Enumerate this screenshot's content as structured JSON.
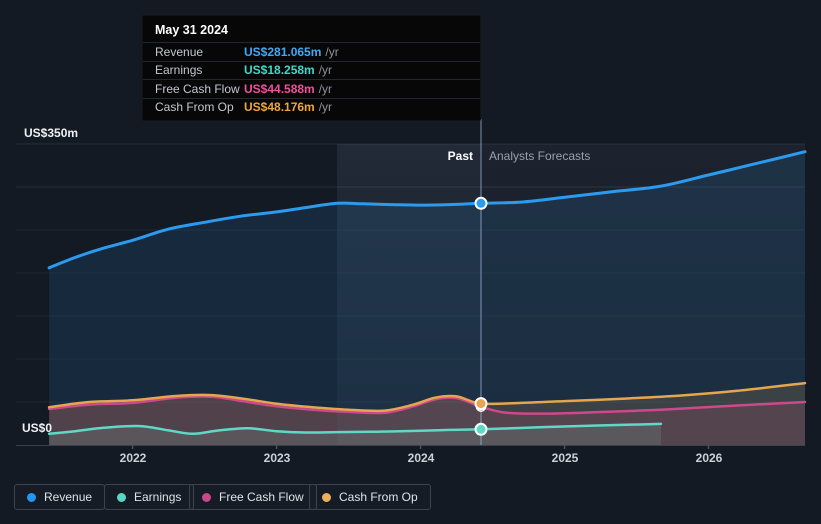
{
  "tooltip": {
    "title": "May 31 2024",
    "unit_suffix": " /yr",
    "rows": [
      {
        "label": "Revenue",
        "value": "US$281.065m",
        "color": "#40aaf5"
      },
      {
        "label": "Earnings",
        "value": "US$18.258m",
        "color": "#3fd9c4"
      },
      {
        "label": "Free Cash Flow",
        "value": "US$44.588m",
        "color": "#f0509d"
      },
      {
        "label": "Cash From Op",
        "value": "US$48.176m",
        "color": "#f0a63e"
      }
    ]
  },
  "axis": {
    "y_top_label": "US$350m",
    "y_zero_label": "US$0",
    "past_label": "Past",
    "forecast_label": "Analysts Forecasts"
  },
  "legend": {
    "items": [
      {
        "label": "Revenue",
        "color": "#2196f3"
      },
      {
        "label": "Earnings",
        "color": "#57d8c4"
      },
      {
        "label": "Free Cash Flow",
        "color": "#c9478c"
      },
      {
        "label": "Cash From Op",
        "color": "#eab05c"
      }
    ]
  },
  "chart_data": {
    "type": "line",
    "unit": "US$ millions per year",
    "ylim": [
      0,
      350
    ],
    "xlim": [
      2021.19,
      2026.67
    ],
    "x_ticks": [
      2022,
      2023,
      2024,
      2025,
      2026
    ],
    "y_gridline_interval": 50,
    "grid": true,
    "divider_x": 2024.42,
    "divider_date": "May 31 2024",
    "highlight_band": [
      2023.42,
      2024.42
    ],
    "forecast_start": 2024.42,
    "series": [
      {
        "name": "Revenue",
        "color": "#2b9bf0",
        "fill": "rgba(45,140,220,0.14)",
        "width": 3,
        "divider_value": 281.065,
        "points": [
          [
            2021.42,
            206
          ],
          [
            2021.6,
            218
          ],
          [
            2021.8,
            229
          ],
          [
            2022.0,
            238
          ],
          [
            2022.25,
            251
          ],
          [
            2022.5,
            259
          ],
          [
            2022.75,
            266
          ],
          [
            2023.0,
            271
          ],
          [
            2023.2,
            276
          ],
          [
            2023.42,
            281
          ],
          [
            2023.6,
            280.5
          ],
          [
            2023.8,
            279.5
          ],
          [
            2024.0,
            279
          ],
          [
            2024.2,
            279.5
          ],
          [
            2024.42,
            281.065
          ],
          [
            2024.7,
            282.5
          ],
          [
            2025.0,
            288
          ],
          [
            2025.3,
            294
          ],
          [
            2025.67,
            301
          ],
          [
            2026.0,
            314
          ],
          [
            2026.3,
            326
          ],
          [
            2026.67,
            341
          ]
        ]
      },
      {
        "name": "Earnings",
        "color": "#5fd9c5",
        "fill": "rgba(95,217,197,0.16)",
        "width": 2.5,
        "divider_value": 18.258,
        "points": [
          [
            2021.42,
            13
          ],
          [
            2021.6,
            16
          ],
          [
            2021.8,
            20
          ],
          [
            2022.05,
            22
          ],
          [
            2022.25,
            17
          ],
          [
            2022.42,
            13
          ],
          [
            2022.6,
            17
          ],
          [
            2022.8,
            19.5
          ],
          [
            2023.0,
            16
          ],
          [
            2023.2,
            14.5
          ],
          [
            2023.42,
            15
          ],
          [
            2023.7,
            15.5
          ],
          [
            2024.0,
            16.5
          ],
          [
            2024.2,
            17.5
          ],
          [
            2024.42,
            18.258
          ],
          [
            2024.8,
            20.5
          ],
          [
            2025.2,
            22.5
          ],
          [
            2025.67,
            24.5
          ]
        ]
      },
      {
        "name": "Free Cash Flow",
        "color": "#cc4a8b",
        "fill": "rgba(204,74,139,0.17)",
        "width": 2.5,
        "divider_value": 44.588,
        "points": [
          [
            2021.42,
            42
          ],
          [
            2021.7,
            47
          ],
          [
            2022.0,
            49
          ],
          [
            2022.3,
            55
          ],
          [
            2022.55,
            56
          ],
          [
            2022.8,
            50
          ],
          [
            2023.0,
            45
          ],
          [
            2023.25,
            41
          ],
          [
            2023.5,
            38.5
          ],
          [
            2023.75,
            37.5
          ],
          [
            2023.95,
            45
          ],
          [
            2024.1,
            53
          ],
          [
            2024.25,
            54.5
          ],
          [
            2024.42,
            44.588
          ],
          [
            2024.6,
            37.5
          ],
          [
            2024.9,
            36.5
          ],
          [
            2025.2,
            38
          ],
          [
            2025.67,
            41
          ],
          [
            2026.1,
            45
          ],
          [
            2026.67,
            50
          ]
        ]
      },
      {
        "name": "Cash From Op",
        "color": "#e6a64f",
        "fill": "rgba(230,166,79,0.16)",
        "width": 2.5,
        "divider_value": 48.176,
        "points": [
          [
            2021.42,
            44
          ],
          [
            2021.7,
            50
          ],
          [
            2022.0,
            52
          ],
          [
            2022.3,
            57
          ],
          [
            2022.55,
            58
          ],
          [
            2022.8,
            53
          ],
          [
            2023.0,
            48
          ],
          [
            2023.25,
            44
          ],
          [
            2023.5,
            41
          ],
          [
            2023.75,
            40
          ],
          [
            2023.95,
            47
          ],
          [
            2024.1,
            55
          ],
          [
            2024.25,
            56.5
          ],
          [
            2024.42,
            48.176
          ],
          [
            2024.7,
            49
          ],
          [
            2025.0,
            51
          ],
          [
            2025.42,
            54
          ],
          [
            2025.8,
            57.5
          ],
          [
            2026.2,
            63
          ],
          [
            2026.67,
            72
          ]
        ]
      }
    ]
  }
}
